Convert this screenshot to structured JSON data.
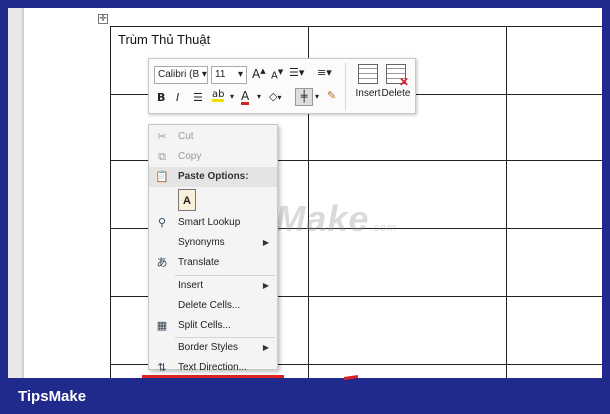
{
  "document": {
    "cell_text": "Trùm Thủ Thuật",
    "table_handle": "✛",
    "watermark": "TipsMake",
    "watermark_suffix": ".com"
  },
  "mini_toolbar": {
    "font_name": "Calibri (B",
    "font_size": "11",
    "insert_label": "Insert",
    "delete_label": "Delete"
  },
  "context_menu": {
    "cut": "Cut",
    "copy": "Copy",
    "paste_options": "Paste Options:",
    "smart_lookup": "Smart Lookup",
    "synonyms": "Synonyms",
    "translate": "Translate",
    "insert": "Insert",
    "delete_cells": "Delete Cells...",
    "split_cells": "Split Cells...",
    "border_styles": "Border Styles",
    "text_direction": "Text Direction..."
  },
  "footer": {
    "brand": "TipsMake"
  },
  "colors": {
    "frame_background": "#1f2a8c",
    "accent_red": "#d22222",
    "highlight_yellow": "#f0e000"
  },
  "icons": [
    "table-move-icon",
    "grow-font-icon",
    "shrink-font-icon",
    "bullets-icon",
    "numbering-icon",
    "bold-icon",
    "italic-icon",
    "center-icon",
    "highlight-icon",
    "font-color-icon",
    "shading-icon",
    "borders-icon",
    "format-painter-icon",
    "insert-table-icon",
    "delete-table-icon",
    "cut-icon",
    "copy-icon",
    "paste-icon",
    "paste-keep-text-icon",
    "smart-lookup-icon",
    "translate-icon",
    "split-cells-icon",
    "text-direction-icon"
  ]
}
